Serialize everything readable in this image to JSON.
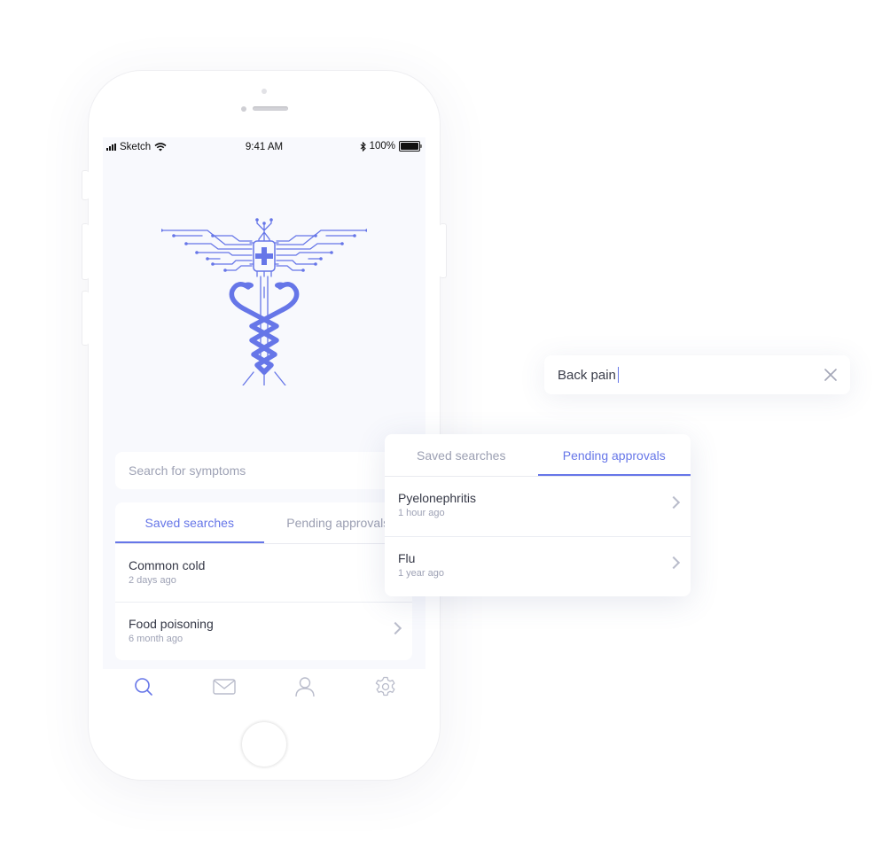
{
  "status_bar": {
    "carrier": "Sketch",
    "time": "9:41 AM",
    "battery": "100%"
  },
  "app": {
    "emblem": "caduceus-circuit-logo",
    "accent_color": "#6676e8",
    "search": {
      "placeholder": "Search for symptoms",
      "value": ""
    },
    "tabs": [
      {
        "label": "Saved searches",
        "active": true
      },
      {
        "label": "Pending approvals",
        "active": false
      }
    ],
    "saved_searches": [
      {
        "title": "Common cold",
        "time": "2 days ago"
      },
      {
        "title": "Food poisoning",
        "time": "6 month ago"
      }
    ],
    "tab_bar": [
      {
        "icon": "search-icon",
        "active": true
      },
      {
        "icon": "mail-icon",
        "active": false
      },
      {
        "icon": "user-icon",
        "active": false
      },
      {
        "icon": "gear-icon",
        "active": false
      }
    ]
  },
  "overlay_search": {
    "value": "Back pain",
    "clear_icon": "close-icon"
  },
  "overlay_card": {
    "tabs": [
      {
        "label": "Saved searches",
        "active": false
      },
      {
        "label": "Pending approvals",
        "active": true
      }
    ],
    "pending_approvals": [
      {
        "title": "Pyelonephritis",
        "time": "1 hour ago"
      },
      {
        "title": "Flu",
        "time": "1 year ago"
      }
    ]
  }
}
